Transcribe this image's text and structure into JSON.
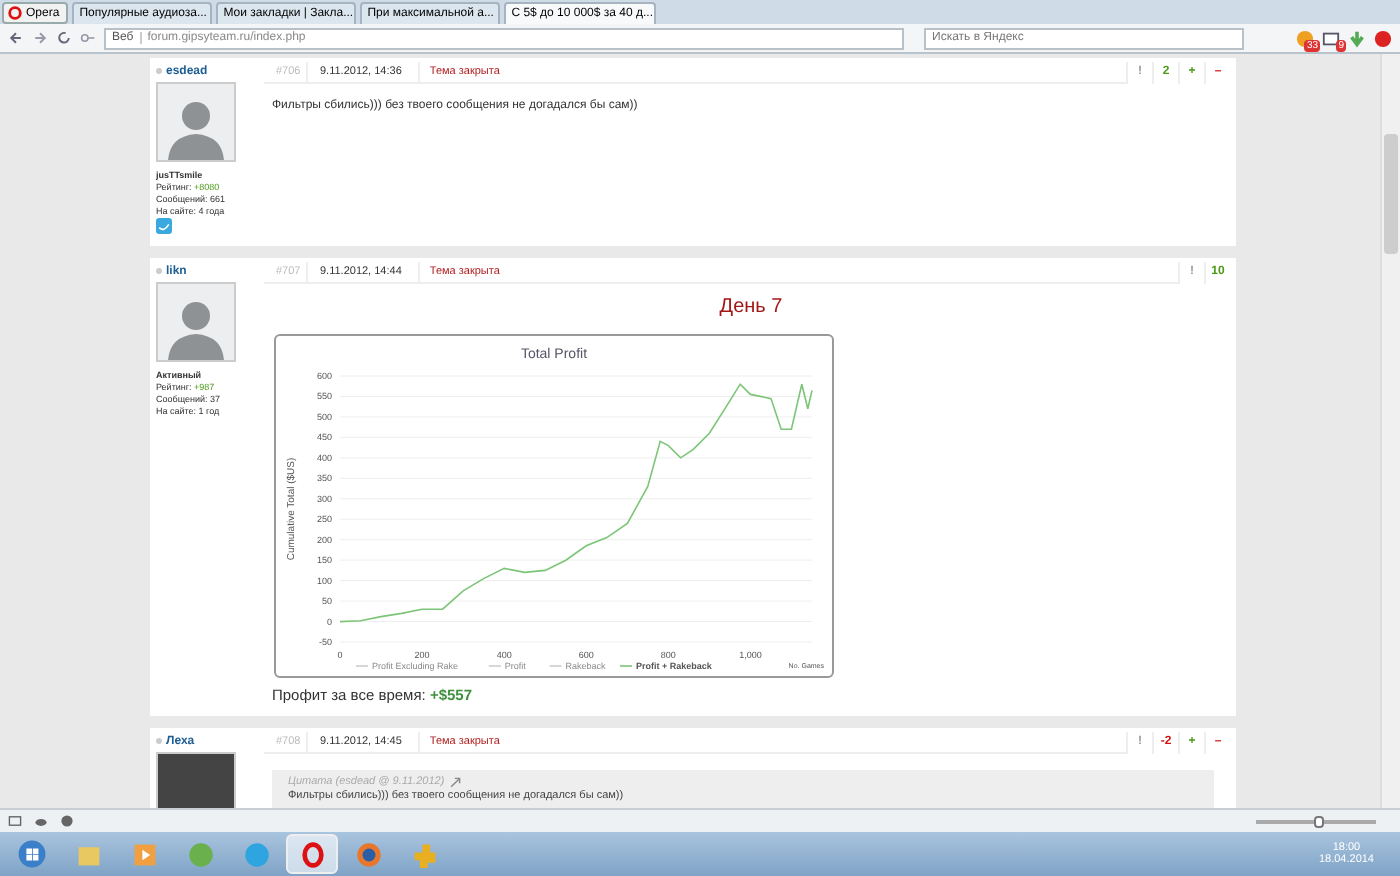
{
  "browser": {
    "menu_button": "Opera",
    "tabs": [
      {
        "label": "Популярные аудиоза...",
        "selected": false
      },
      {
        "label": "Мои закладки | Закла...",
        "selected": false
      },
      {
        "label": "При максимальной а...",
        "selected": false
      },
      {
        "label": "С 5$ до 10 000$ за 40 д...",
        "selected": true
      }
    ],
    "address": {
      "badge": "Веб",
      "url": "forum.gipsyteam.ru/index.php"
    },
    "search": {
      "placeholder": "Искать в Яндекс"
    },
    "mail_count": "33",
    "notes_count": "9"
  },
  "posts": [
    {
      "author": "esdead",
      "avatar": {
        "kind": "silhouette"
      },
      "rank": "jusTTsmile",
      "rating_label": "Рейтинг:",
      "rating": "+8080",
      "info": [
        "Сообщений: 661",
        "На сайте: 4 года"
      ],
      "twitter": true,
      "number": "#706",
      "date": "9.11.2012, 14:36",
      "status": "Тема закрыта",
      "votes": [
        {
          "text": "!",
          "kind": "report"
        },
        {
          "text": "2",
          "kind": "positive"
        },
        {
          "text": "+",
          "kind": "plus"
        },
        {
          "text": "–",
          "kind": "minus"
        }
      ],
      "blocks": [
        {
          "kind": "text",
          "text": "Фильтры сбились))) без твоего сообщения не догадался бы сам))"
        }
      ]
    },
    {
      "author": "likn",
      "avatar": {
        "kind": "silhouette"
      },
      "rank": "Активный",
      "rating_label": "Рейтинг:",
      "rating": "+987",
      "info": [
        "Сообщений: 37",
        "На сайте: 1 год"
      ],
      "twitter": false,
      "number": "#707",
      "date": "9.11.2012, 14:44",
      "status": "Тема закрыта",
      "votes": [
        {
          "text": "!",
          "kind": "report"
        },
        {
          "text": "10",
          "kind": "positive"
        }
      ],
      "blocks": [
        {
          "kind": "heading",
          "text": "День 7"
        },
        {
          "kind": "chart",
          "hidden_series": [
            "Profit Excluding Rake",
            "Profit",
            "Rakeback"
          ],
          "chart_data": {
            "type": "line",
            "grid": true,
            "title": "Total Profit",
            "xlabel": "No. Games",
            "ylabel": "Cumulative Total ($US)",
            "xlim": [
              0,
              1150
            ],
            "ylim": [
              -50,
              600
            ],
            "xticks": [
              0,
              200,
              400,
              600,
              800,
              {
                "value": 1000,
                "label": "1,000"
              }
            ],
            "yticks": [
              -50,
              0,
              50,
              100,
              150,
              200,
              250,
              300,
              350,
              400,
              450,
              500,
              550,
              600
            ],
            "x": [
              0,
              50,
              100,
              150,
              200,
              250,
              300,
              350,
              400,
              450,
              500,
              550,
              600,
              650,
              700,
              750,
              780,
              800,
              830,
              860,
              900,
              950,
              975,
              1000,
              1050,
              1075,
              1100,
              1125,
              1140,
              1150
            ],
            "series": [
              {
                "name": "Profit + Rakeback",
                "color": "#7cc576",
                "values": [
                  0,
                  2,
                  12,
                  20,
                  30,
                  30,
                  75,
                  105,
                  130,
                  120,
                  125,
                  150,
                  185,
                  205,
                  240,
                  330,
                  440,
                  430,
                  400,
                  420,
                  460,
                  540,
                  580,
                  555,
                  545,
                  470,
                  470,
                  580,
                  520,
                  565
                ]
              }
            ]
          }
        },
        {
          "kind": "profit",
          "label": "Профит за все время:",
          "value": "+$557"
        }
      ]
    },
    {
      "author": "Леха",
      "avatar": {
        "kind": "photo"
      },
      "twitter": false,
      "number": "#708",
      "date": "9.11.2012, 14:45",
      "status": "Тема закрыта",
      "votes": [
        {
          "text": "!",
          "kind": "report"
        },
        {
          "text": "-2",
          "kind": "negative"
        },
        {
          "text": "+",
          "kind": "plus"
        },
        {
          "text": "–",
          "kind": "minus"
        }
      ],
      "blocks": [
        {
          "kind": "quote",
          "header": "Цитата (esdead @ 9.11.2012)",
          "text": "Фильтры сбились))) без твоего сообщения не догадался бы сам))"
        }
      ]
    }
  ],
  "status_bar": {
    "zoom_slider": {
      "level": 0.52
    }
  },
  "taskbar": {
    "time": "18:00",
    "date": "18.04.2014"
  }
}
